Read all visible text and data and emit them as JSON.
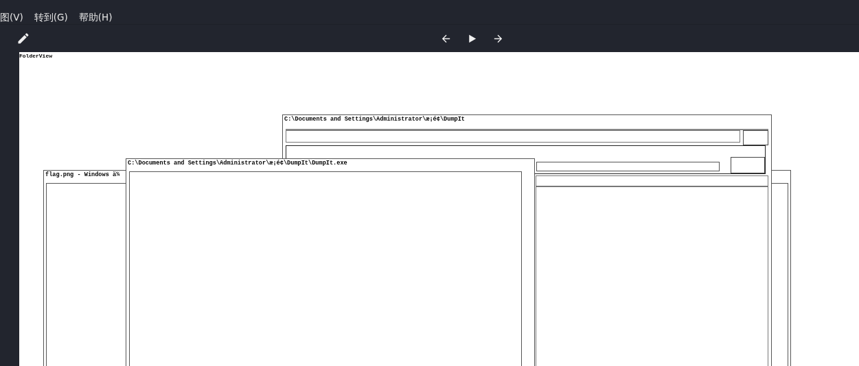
{
  "menu": [
    {
      "label": "图(V)"
    },
    {
      "label": "转到(G)"
    },
    {
      "label": "帮助(H)"
    }
  ],
  "toolbar": {
    "tools": [
      {
        "kind": "edit"
      }
    ],
    "nav": [
      {
        "kind": "back"
      },
      {
        "kind": "play"
      },
      {
        "kind": "forward"
      }
    ]
  },
  "canvas": {
    "label": "FolderView",
    "windows": [
      {
        "kind": "image",
        "title": "flag.png - Windows ä¼"
      },
      {
        "kind": "folder",
        "title": "C:\\Documents and Settings\\Administrator\\æ¡é¢\\DumpIt"
      },
      {
        "kind": "app",
        "title": "C:\\Documents and Settings\\Administrator\\æ¡é¢\\DumpIt\\DumpIt.exe"
      }
    ]
  }
}
